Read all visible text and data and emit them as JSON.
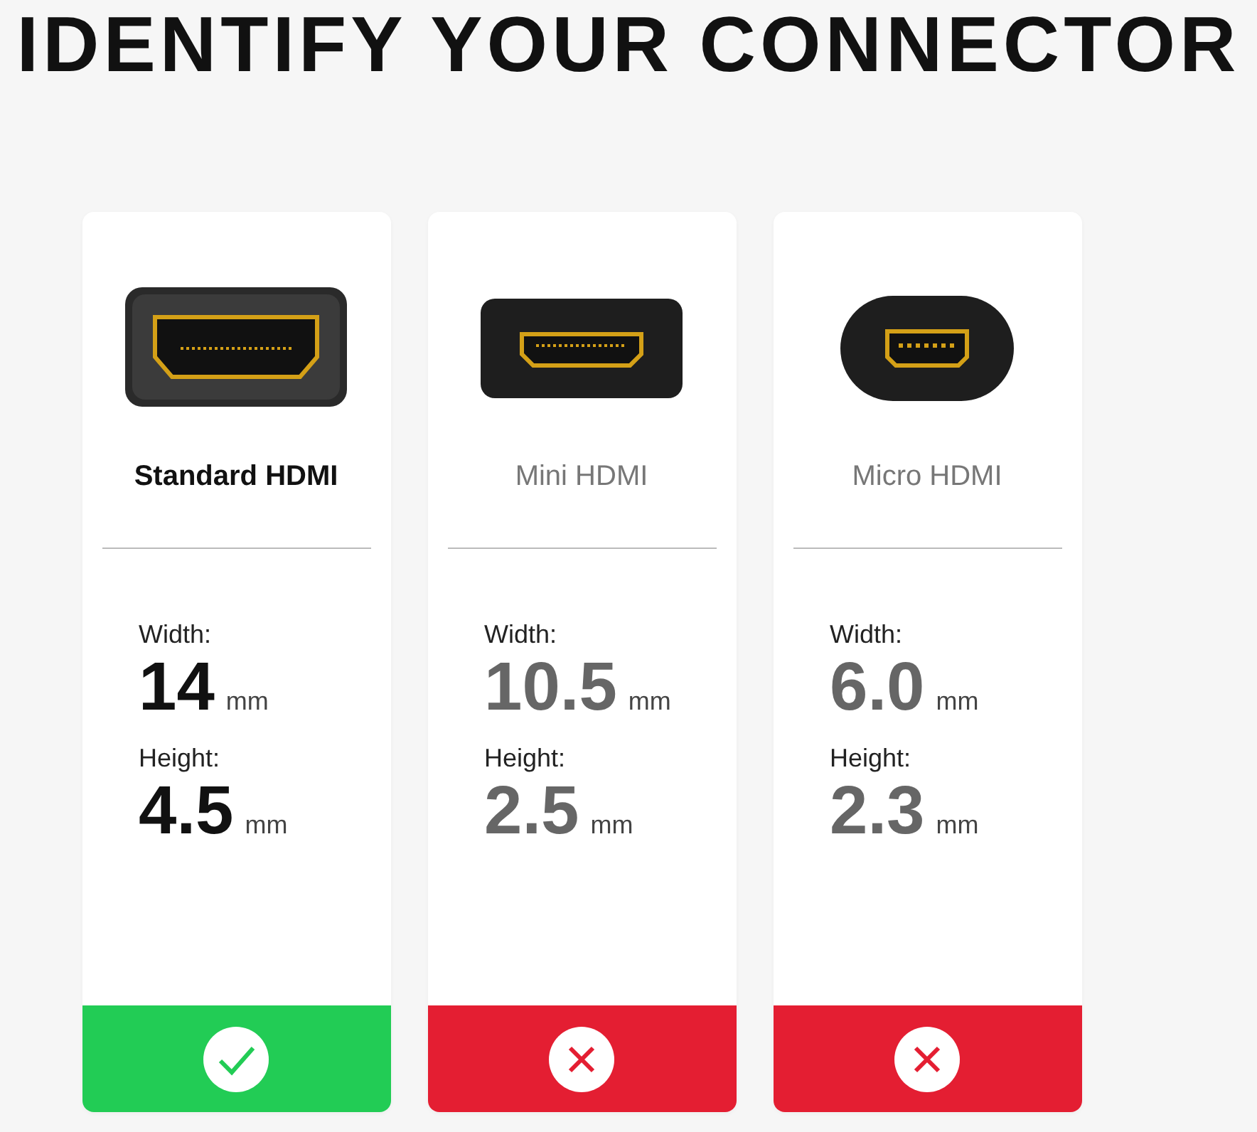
{
  "title": "IDENTIFY YOUR CONNECTOR",
  "cards": [
    {
      "kind": "standard",
      "name": "Standard HDMI",
      "compatible": true,
      "width_label": "Width:",
      "width_value": "14",
      "width_unit": "mm",
      "height_label": "Height:",
      "height_value": "4.5",
      "height_unit": "mm"
    },
    {
      "kind": "mini",
      "name": "Mini HDMI",
      "compatible": false,
      "width_label": "Width:",
      "width_value": "10.5",
      "width_unit": "mm",
      "height_label": "Height:",
      "height_value": "2.5",
      "height_unit": "mm"
    },
    {
      "kind": "micro",
      "name": "Micro HDMI",
      "compatible": false,
      "width_label": "Width:",
      "width_value": "6.0",
      "width_unit": "mm",
      "height_label": "Height:",
      "height_value": "2.3",
      "height_unit": "mm"
    }
  ]
}
